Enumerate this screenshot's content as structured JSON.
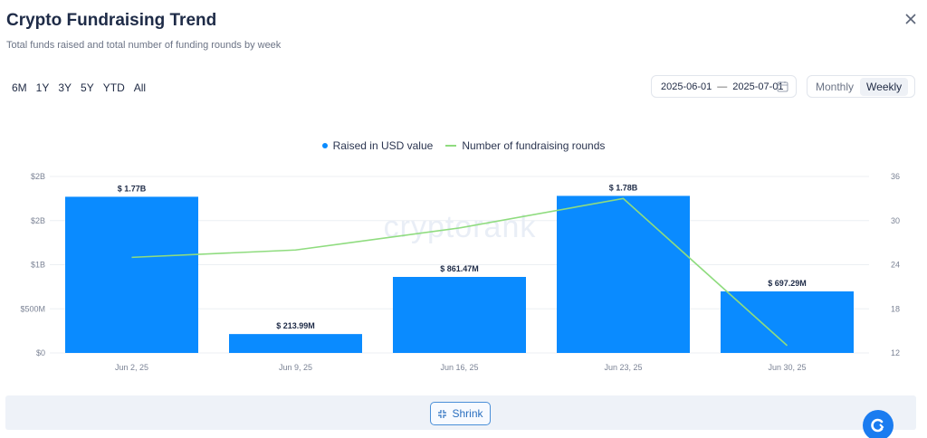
{
  "header": {
    "title": "Crypto Fundraising Trend",
    "subtitle": "Total funds raised and total number of funding rounds by week"
  },
  "ranges": [
    "6M",
    "1Y",
    "3Y",
    "5Y",
    "YTD",
    "All"
  ],
  "date_range": {
    "start": "2025-06-01",
    "separator": "—",
    "end": "2025-07-01"
  },
  "period": {
    "options": [
      "Monthly",
      "Weekly"
    ],
    "selected": "Weekly"
  },
  "watermark": "cryptorank",
  "footer": {
    "shrink_label": "Shrink"
  },
  "colors": {
    "bar": "#0a8bff",
    "line": "#8fdc7f",
    "grid": "#eceff3"
  },
  "chart_data": {
    "type": "bar",
    "categories": [
      "Jun 2, 25",
      "Jun 9, 25",
      "Jun 16, 25",
      "Jun 23, 25",
      "Jun 30, 25"
    ],
    "series": [
      {
        "name": "Raised in USD value",
        "type": "bar",
        "axis": "left",
        "values": [
          1770000000,
          213990000,
          861470000,
          1780000000,
          697290000
        ],
        "labels": [
          "$ 1.77B",
          "$ 213.99M",
          "$ 861.47M",
          "$ 1.78B",
          "$ 697.29M"
        ]
      },
      {
        "name": "Number of fundraising rounds",
        "type": "line",
        "axis": "right",
        "values": [
          25,
          26,
          29,
          33,
          13
        ]
      }
    ],
    "y_left": {
      "ticks": [
        "$0",
        "$500M",
        "$1B",
        "$2B",
        "$2B"
      ],
      "ylim": [
        0,
        2000000000
      ]
    },
    "y_right": {
      "ticks": [
        "12",
        "18",
        "24",
        "30",
        "36"
      ],
      "ylim": [
        12,
        36
      ]
    },
    "legend_position": "top-center",
    "grid": true
  }
}
